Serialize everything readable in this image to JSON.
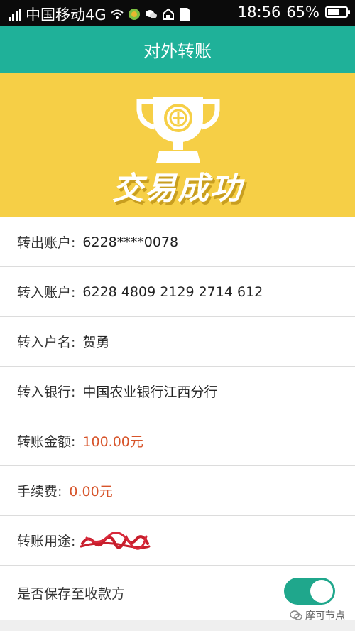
{
  "status_bar": {
    "carrier": "中国移动4G",
    "time": "18:56",
    "battery_percent": "65%",
    "battery_level": 0.65
  },
  "header": {
    "title": "对外转账"
  },
  "banner": {
    "success_text": "交易成功"
  },
  "details": {
    "from_account": {
      "label": "转出账户:",
      "value": "6228****0078"
    },
    "to_account": {
      "label": "转入账户:",
      "value": "6228 4809 2129 2714 612"
    },
    "payee_name": {
      "label": "转入户名:",
      "value": "贺勇"
    },
    "payee_bank": {
      "label": "转入银行:",
      "value": "中国农业银行江西分行"
    },
    "amount": {
      "label": "转账金额:",
      "value": "100.00元"
    },
    "fee": {
      "label": "手续费:",
      "value": "0.00元"
    },
    "purpose": {
      "label": "转账用途:"
    },
    "save_payee": {
      "label": "是否保存至收款方",
      "enabled": true
    }
  },
  "watermark": {
    "text": "摩可节点"
  },
  "colors": {
    "accent": "#1fb199",
    "banner": "#f6cf46",
    "money": "#d7542a",
    "toggle": "#1fa78c"
  }
}
